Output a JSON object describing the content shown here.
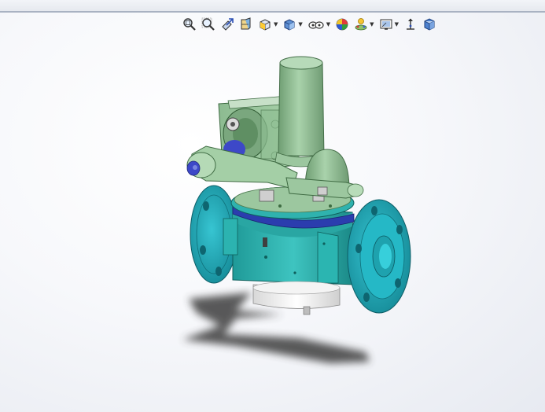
{
  "app": {
    "window_strip_color": "#e9ecf2"
  },
  "toolbar": {
    "items": [
      {
        "id": "zoom-to-fit",
        "icon": "magnifier-fit-icon",
        "dropdown": false
      },
      {
        "id": "zoom-to-area",
        "icon": "magnifier-area-icon",
        "dropdown": false
      },
      {
        "id": "previous-view",
        "icon": "previous-view-icon",
        "dropdown": false
      },
      {
        "id": "section-view",
        "icon": "section-view-icon",
        "dropdown": false
      },
      {
        "id": "view-orientation",
        "icon": "view-orientation-icon",
        "dropdown": true
      },
      {
        "id": "display-style",
        "icon": "display-style-icon",
        "dropdown": true
      },
      {
        "id": "hide-show-items",
        "icon": "hide-show-icon",
        "dropdown": true
      },
      {
        "id": "edit-appearance",
        "icon": "appearance-icon",
        "dropdown": false
      },
      {
        "id": "apply-scene",
        "icon": "scene-icon",
        "dropdown": true
      },
      {
        "id": "view-settings",
        "icon": "view-settings-icon",
        "dropdown": true
      },
      {
        "id": "rotate-view",
        "icon": "rotate-icon",
        "dropdown": false
      },
      {
        "id": "3d-view",
        "icon": "cube-icon",
        "dropdown": false
      }
    ]
  },
  "model": {
    "body_color": "#2fb3b0",
    "flange_color": "#1fa7b4",
    "actuator_color": "#9cc79f",
    "band_color": "#2e3fb0",
    "base_color": "#f4f4f4",
    "shadow_color": "#4a4a4a"
  }
}
